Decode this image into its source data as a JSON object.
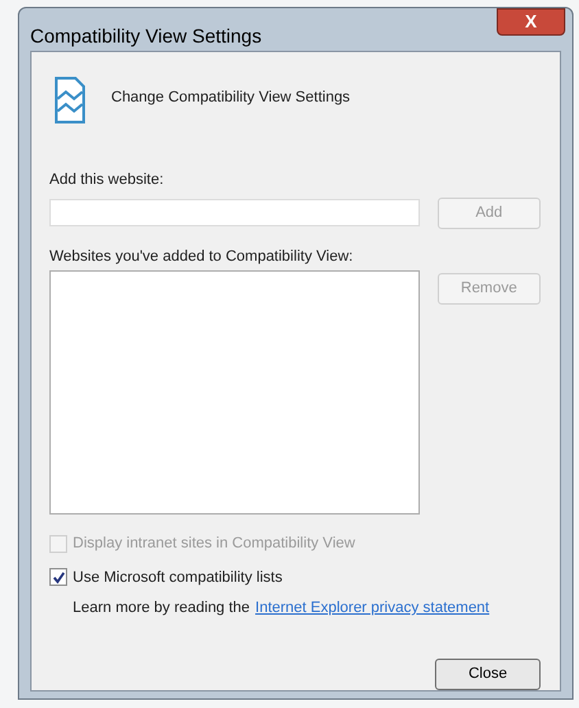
{
  "window": {
    "title": "Compatibility View Settings",
    "close_label": "X"
  },
  "header": {
    "text": "Change Compatibility View Settings"
  },
  "add_website": {
    "label": "Add this website:",
    "button": {
      "label": "Add",
      "disabled": true
    }
  },
  "websites_list": {
    "label": "Websites you've added to Compatibility View:",
    "button": {
      "label": "Remove",
      "disabled": true
    }
  },
  "options": [
    {
      "label": "Display intranet sites in Compatibility View",
      "checked": false,
      "disabled": true
    },
    {
      "label": "Use Microsoft compatibility lists",
      "checked": true,
      "disabled": false
    }
  ],
  "learn_more": {
    "text": "Learn more by reading the",
    "link": "Internet Explorer privacy statement"
  },
  "buttons": [
    {
      "label": "Close"
    }
  ]
}
